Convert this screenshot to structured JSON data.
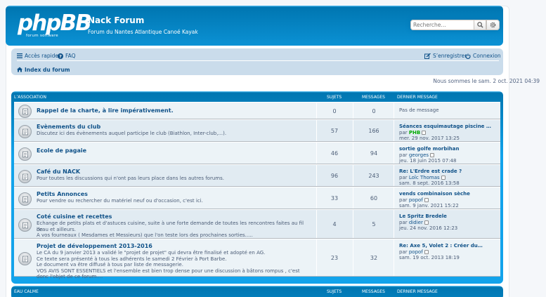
{
  "header": {
    "logo_text": "phpBB",
    "logo_sub": "forum software",
    "site_title": "Nack Forum",
    "site_desc": "Forum du Nantes Atlantique Canoé Kayak",
    "search_placeholder": "Recherche…"
  },
  "nav": {
    "quick_access": "Accès rapide",
    "faq": "FAQ",
    "register": "S’enregistrer",
    "login": "Connexion",
    "breadcrumb": "Index du forum"
  },
  "date_text": "Nous sommes le sam. 2 oct. 2021 04:39",
  "categories": [
    {
      "name": "L’ASSOCIATION",
      "col_topics": "SUJETS",
      "col_posts": "MESSAGES",
      "col_last": "DERNIER MESSAGE",
      "forums": [
        {
          "title": "Rappel de la charte, à lire impérativement.",
          "desc": [],
          "topics": "0",
          "posts": "0",
          "last_title": "",
          "last_by_prefix": "",
          "last_by": "",
          "last_date": "",
          "no_post": "Pas de message"
        },
        {
          "title": "Evènements du club",
          "desc": [
            "Discutez ici des évènements auquel participe le club (Biathlon, Inter-club,...)."
          ],
          "topics": "57",
          "posts": "166",
          "last_title": "Séances esquimautage piscine …",
          "last_by_prefix": "par",
          "last_by": "PHB",
          "last_date": "mer. 29 nov. 2017 13:25",
          "no_post": ""
        },
        {
          "title": "Ecole de pagaie",
          "desc": [],
          "topics": "46",
          "posts": "94",
          "last_title": "sortie golfe morbihan",
          "last_by_prefix": "par",
          "last_by": "georges",
          "last_date": "jeu. 18 juin 2015 07:48",
          "no_post": ""
        },
        {
          "title": "Café du NACK",
          "desc": [
            "Pour toutes les discussions qui n'ont pas leurs place dans les autres forums."
          ],
          "topics": "96",
          "posts": "243",
          "last_title": "Re: L'Erdre est crade ?",
          "last_by_prefix": "par",
          "last_by": "Loïc Thomas",
          "last_date": "sam. 8 sept. 2016 13:58",
          "no_post": ""
        },
        {
          "title": "Petits Annonces",
          "desc": [
            "Pour vendre ou rechercher du matériel neuf ou d'occasion, c'est ici."
          ],
          "topics": "33",
          "posts": "60",
          "last_title": "vends combinaison sèche",
          "last_by_prefix": "par",
          "last_by": "popof",
          "last_date": "sam. 9 janv. 2021 15:22",
          "no_post": ""
        },
        {
          "title": "Coté cuisine et recettes",
          "desc": [
            "Echange de petits plats et d'astuces cuisine, suite à une forte demande de toutes les rencontres faites au fil de",
            "l'eau et ailleurs.",
            "A vos fourneaux ( Mesdames et Messieurs) que l'on teste lors des prochaines sorties....."
          ],
          "topics": "4",
          "posts": "5",
          "last_title": "Le Spritz Bredele",
          "last_by_prefix": "par",
          "last_by": "didier",
          "last_date": "jeu. 24 nov. 2016 12:23",
          "no_post": ""
        },
        {
          "title": "Projet de développement 2013-2016",
          "desc": [
            "Le CA du 9 janvier 2013 a validé le \"projet de projet\" qui devra être finalisé et adopté en AG.",
            "Ce texte sera présenté à tous les adhérents le samedi 2 Février à Port Barbe.",
            "Le document va être diffusé à tous par liste de messagerie.",
            "VOS AVIS SONT ESSENTIELS et l'ensemble est bien trop dense pour une discussion à bâtons rompus , c'est",
            "donc l'objet de ce forum...."
          ],
          "topics": "23",
          "posts": "32",
          "last_title": "Re: Axe 5, Volet 2 : Créer du…",
          "last_by_prefix": "par",
          "last_by": "popof",
          "last_date": "sam. 19 oct. 2013 18:19",
          "no_post": ""
        }
      ]
    },
    {
      "name": "EAU CALME",
      "col_topics": "SUJETS",
      "col_posts": "MESSAGES",
      "col_last": "DERNIER MESSAGE",
      "forums": []
    }
  ]
}
